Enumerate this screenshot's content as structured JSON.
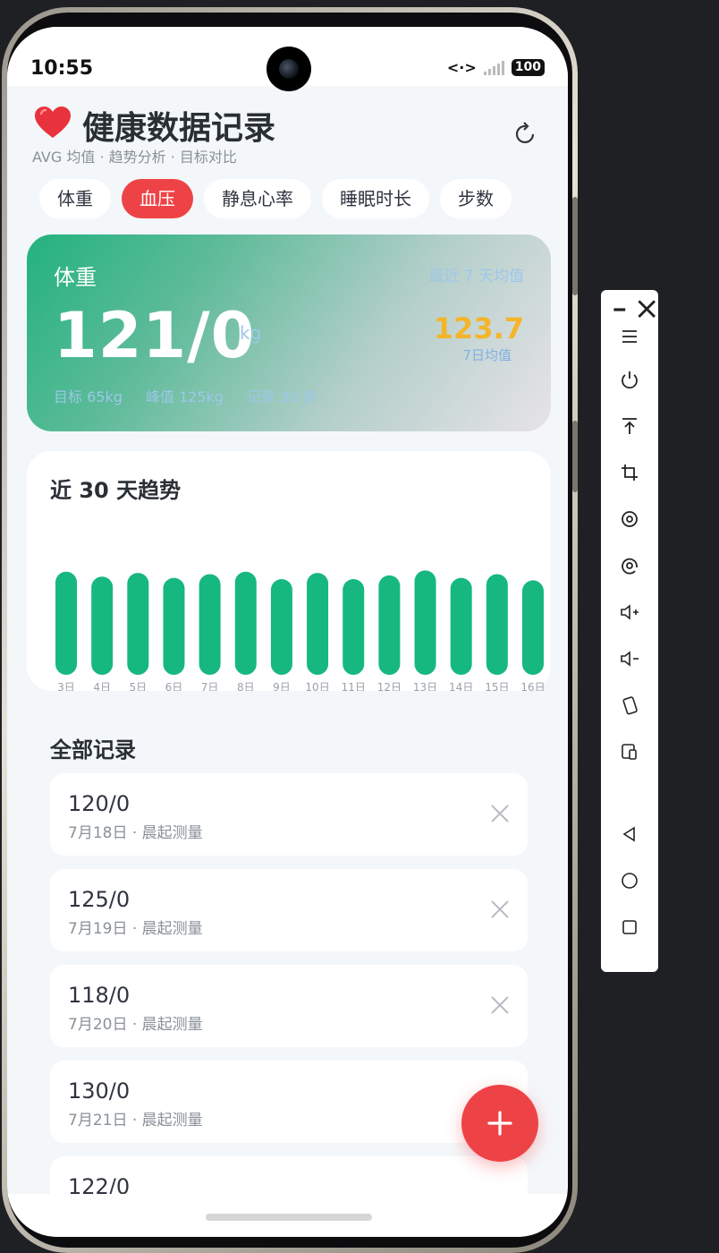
{
  "status_bar": {
    "time": "10:55",
    "battery": "100"
  },
  "header": {
    "title": "健康数据记录",
    "subtitle": "AVG 均值 · 趋势分析 · 目标对比",
    "heart_icon": "heart-icon",
    "refresh_icon": "refresh-icon"
  },
  "tabs": [
    {
      "label": "体重",
      "active": false
    },
    {
      "label": "血压",
      "active": true
    },
    {
      "label": "静息心率",
      "active": false
    },
    {
      "label": "睡眠时长",
      "active": false
    },
    {
      "label": "步数",
      "active": false
    }
  ],
  "summary": {
    "metric": "体重",
    "range": "最近 7 天均值",
    "value": "121/0",
    "unit": "kg",
    "avg_value": "123.7",
    "avg_label": "7日均值",
    "target": "目标 65kg",
    "peak": "峰值 125kg",
    "count": "记录 30 条"
  },
  "trend": {
    "title": "近 30 天趋势"
  },
  "chart_data": {
    "type": "bar",
    "categories": [
      "3日",
      "4日",
      "5日",
      "6日",
      "7日",
      "8日",
      "9日",
      "10日",
      "11日",
      "12日",
      "13日",
      "14日",
      "15日",
      "16日"
    ],
    "values": [
      124,
      120,
      123,
      119,
      122,
      124,
      118,
      123,
      118,
      121,
      125,
      119,
      122,
      117
    ],
    "title": "近 30 天趋势",
    "ylim": [
      0,
      130
    ],
    "bar_color": "#16b880"
  },
  "records": {
    "title": "全部记录",
    "items": [
      {
        "value": "120/0",
        "date": "7月18日 · 晨起测量",
        "action_icon": "close-icon"
      },
      {
        "value": "125/0",
        "date": "7月19日 · 晨起测量",
        "action_icon": "close-icon"
      },
      {
        "value": "118/0",
        "date": "7月20日 · 晨起测量",
        "action_icon": "close-icon"
      },
      {
        "value": "130/0",
        "date": "7月21日 · 晨起测量",
        "action_icon": "close-icon"
      },
      {
        "value": "122/0",
        "date": "",
        "action_icon": "chevron-down-icon"
      }
    ]
  },
  "fab": {
    "icon": "plus-icon"
  },
  "colors": {
    "accent": "#ee4346",
    "green": "#16b880",
    "gold": "#f4b52a"
  },
  "toolbar": {
    "items": [
      "minimize-icon",
      "close-icon",
      "menu-icon",
      "power-icon",
      "pin-top-icon",
      "crop-icon",
      "rotate-icon",
      "screenshot-icon",
      "volume-up-icon",
      "volume-down-icon",
      "rotate-device-icon",
      "device-icon",
      "back-icon",
      "home-icon",
      "recents-icon"
    ]
  }
}
